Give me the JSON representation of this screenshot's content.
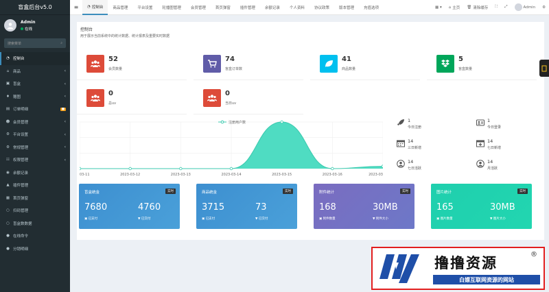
{
  "app": {
    "title": "盲盒后台v5.0"
  },
  "user": {
    "name": "Admin",
    "status": "在线"
  },
  "search": {
    "placeholder": "搜索菜单"
  },
  "sidebar": {
    "items": [
      {
        "label": "控制台",
        "icon": "dashboard-icon",
        "glyph": "◔",
        "active": true,
        "arrow": ""
      },
      {
        "label": "商品",
        "icon": "home-icon",
        "glyph": "⌂",
        "arrow": "‹"
      },
      {
        "label": "盲盒",
        "icon": "box-icon",
        "glyph": "▣",
        "arrow": "‹"
      },
      {
        "label": "赠图",
        "icon": "gift-icon",
        "glyph": "♦",
        "arrow": "‹"
      },
      {
        "label": "订单明细",
        "icon": "cart-icon",
        "glyph": "▤",
        "arrow": "",
        "badge": "■"
      },
      {
        "label": "会员管理",
        "icon": "users-icon",
        "glyph": "☻",
        "arrow": "‹"
      },
      {
        "label": "平台设置",
        "icon": "settings-icon",
        "glyph": "⚙",
        "arrow": "‹"
      },
      {
        "label": "常规管理",
        "icon": "gear-icon",
        "glyph": "⚙",
        "arrow": "‹"
      },
      {
        "label": "权限管理",
        "icon": "group-icon",
        "glyph": "☷",
        "arrow": "‹"
      },
      {
        "label": "余额记录",
        "icon": "wallet-icon",
        "glyph": "◉",
        "arrow": ""
      },
      {
        "label": "插件管理",
        "icon": "rocket-icon",
        "glyph": "▲",
        "arrow": ""
      },
      {
        "label": "首页弹窗",
        "icon": "image-icon",
        "glyph": "▦",
        "arrow": ""
      },
      {
        "label": "扫码管理",
        "icon": "circle-icon",
        "glyph": "○",
        "arrow": ""
      },
      {
        "label": "盲盒数数据",
        "icon": "circle-icon",
        "glyph": "○",
        "arrow": ""
      },
      {
        "label": "在线命令",
        "icon": "terminal-icon",
        "glyph": "●",
        "arrow": ""
      },
      {
        "label": "分销明细",
        "icon": "share-icon",
        "glyph": "●",
        "arrow": ""
      }
    ]
  },
  "topnav": {
    "items": [
      "控制台",
      "商品管理",
      "平台设置",
      "轮播图管理",
      "会员管理",
      "首页弹窗",
      "插件管理",
      "余额记录",
      "个人资料",
      "协议政策",
      "版本管理",
      "充值选项"
    ],
    "right": {
      "home": "主页",
      "clear": "清除缓存",
      "user": "Admin"
    }
  },
  "page": {
    "title": "控制台",
    "subtitle": "用于展示当前系统中的统计数据、统计报表及重要实时数据"
  },
  "stats": [
    {
      "value": "52",
      "label": "会员数量",
      "color": "#dd4b39",
      "icon": "users-icon"
    },
    {
      "value": "74",
      "label": "盲盒订单数",
      "color": "#605ca8",
      "icon": "cart-icon"
    },
    {
      "value": "41",
      "label": "商品数量",
      "color": "#00c0ef",
      "icon": "leaf-icon"
    },
    {
      "value": "5",
      "label": "盲盒数量",
      "color": "#00a65a",
      "icon": "dropbox-icon"
    },
    {
      "value": "0",
      "label": "总uv",
      "color": "#dd4b39",
      "icon": "users-icon"
    },
    {
      "value": "0",
      "label": "当日uv",
      "color": "#dd4b39",
      "icon": "users-icon"
    }
  ],
  "chart_data": {
    "type": "area",
    "legend": "注册用户数",
    "x": [
      "03-11",
      "2023-03-12",
      "2023-03-13",
      "2023-03-14",
      "2023-03-15",
      "2023-03-16",
      "2023-03"
    ],
    "values": [
      0,
      0,
      0,
      0,
      1,
      0,
      0.05
    ],
    "color": "#4fdcc2",
    "grid": true
  },
  "mini_stats": [
    {
      "value": "1",
      "label": "今日注册",
      "icon": "rocket-icon"
    },
    {
      "value": "1",
      "label": "今日登录",
      "icon": "id-card-icon"
    },
    {
      "value": "14",
      "label": "三日新增",
      "icon": "calendar-icon"
    },
    {
      "value": "14",
      "label": "七日新增",
      "icon": "calendar-plus-icon"
    },
    {
      "value": "14",
      "label": "七日活跃",
      "icon": "user-circle-icon"
    },
    {
      "value": "14",
      "label": "月活跃",
      "icon": "user-circle-icon"
    }
  ],
  "cards": [
    {
      "title": "盲盒统金",
      "tag": "实时",
      "v1": "7680",
      "v2": "4760",
      "l1": "已支付",
      "l2": "已交付",
      "color": "#3d8fd0",
      "color2": "#4aa0d9"
    },
    {
      "title": "商品统金",
      "tag": "实时",
      "v1": "3715",
      "v2": "73",
      "l1": "已支付",
      "l2": "已交付",
      "color": "#3d8fd0",
      "color2": "#4aa0d9"
    },
    {
      "title": "附件统计",
      "tag": "实时",
      "v1": "168",
      "v2": "30MB",
      "l1": "附件数量",
      "l2": "附件大小",
      "color": "#7a6cc0",
      "color2": "#6d78c8"
    },
    {
      "title": "图片统计",
      "tag": "实时",
      "v1": "165",
      "v2": "30MB",
      "l1": "图片数量",
      "l2": "图片大小",
      "color": "#1fcfae",
      "color2": "#22d6b0"
    }
  ],
  "watermark": {
    "title": "撸撸资源",
    "sub": "白嫖互联网资源的网站",
    "reg": "®"
  }
}
